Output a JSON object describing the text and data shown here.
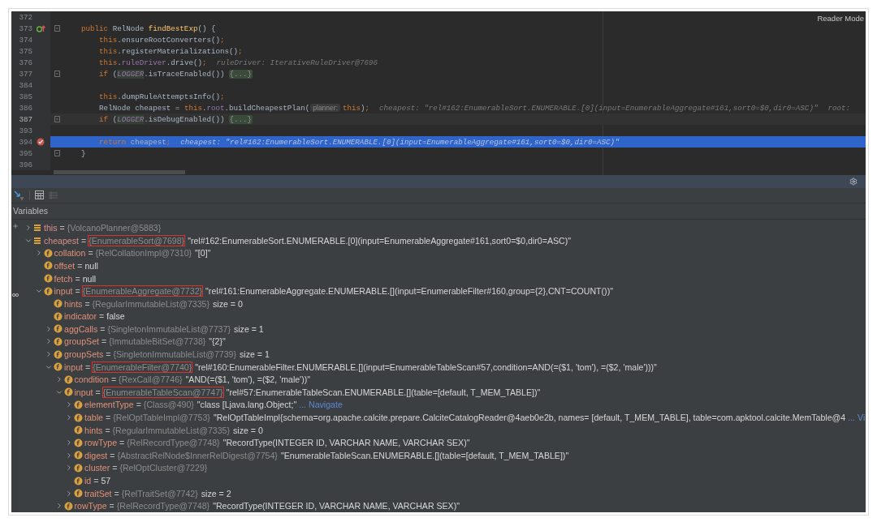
{
  "editor": {
    "reader_mode": "Reader Mode",
    "lines": [
      {
        "number": "372"
      },
      {
        "number": "373",
        "override": true,
        "fold": true,
        "parts": [
          {
            "kind": "code",
            "tokens": [
              {
                "kind": "kw",
                "t": "    public "
              },
              {
                "kind": "plain",
                "t": "RelNode "
              },
              {
                "kind": "method",
                "t": "findBestExp"
              },
              {
                "kind": "plain",
                "t": "() {"
              }
            ]
          }
        ]
      },
      {
        "number": "374",
        "parts": [
          {
            "kind": "code",
            "tokens": [
              {
                "kind": "kw",
                "t": "        this"
              },
              {
                "kind": "plain",
                "t": ".ensureRootConverters()"
              },
              {
                "kind": "kw",
                "t": ";"
              }
            ]
          }
        ]
      },
      {
        "number": "375",
        "parts": [
          {
            "kind": "code",
            "tokens": [
              {
                "kind": "kw",
                "t": "        this"
              },
              {
                "kind": "plain",
                "t": ".registerMaterializations()"
              },
              {
                "kind": "kw",
                "t": ";"
              }
            ]
          }
        ]
      },
      {
        "number": "376",
        "parts": [
          {
            "kind": "code",
            "tokens": [
              {
                "kind": "kw",
                "t": "        this"
              },
              {
                "kind": "plain",
                "t": "."
              },
              {
                "kind": "field",
                "t": "ruleDriver"
              },
              {
                "kind": "plain",
                "t": ".drive()"
              },
              {
                "kind": "kw",
                "t": ";"
              }
            ]
          },
          {
            "kind": "hint",
            "text": "ruleDriver: IterativeRuleDriver@7696"
          }
        ]
      },
      {
        "number": "377",
        "fold": true,
        "parts": [
          {
            "kind": "code",
            "tokens": [
              {
                "kind": "kw",
                "t": "        if "
              },
              {
                "kind": "plain",
                "t": "("
              },
              {
                "kind": "const",
                "t": "LOGGER"
              },
              {
                "kind": "plain",
                "t": ".isTraceEnabled())"
              }
            ]
          },
          {
            "kind": "fold",
            "text": "{...}"
          }
        ]
      },
      {
        "number": "384"
      },
      {
        "number": "385",
        "parts": [
          {
            "kind": "code",
            "tokens": [
              {
                "kind": "kw",
                "t": "        this"
              },
              {
                "kind": "plain",
                "t": ".dumpRuleAttemptsInfo()"
              },
              {
                "kind": "kw",
                "t": ";"
              }
            ]
          }
        ]
      },
      {
        "number": "386",
        "parts": [
          {
            "kind": "code",
            "tokens": [
              {
                "kind": "plain",
                "t": "        RelNode cheapest = "
              },
              {
                "kind": "kw",
                "t": "this"
              },
              {
                "kind": "plain",
                "t": "."
              },
              {
                "kind": "field",
                "t": "root"
              },
              {
                "kind": "plain",
                "t": ".buildCheapestPlan("
              }
            ]
          },
          {
            "kind": "param",
            "text": "planner:"
          },
          {
            "kind": "code",
            "tokens": [
              {
                "kind": "kw",
                "t": "this"
              },
              {
                "kind": "plain",
                "t": ")"
              },
              {
                "kind": "kw",
                "t": ";"
              }
            ]
          },
          {
            "kind": "hint",
            "text": "cheapest: \"rel#162:EnumerableSort.ENUMERABLE.[0](input=EnumerableAggregate#161,sort0=$0,dir0=ASC)\""
          },
          {
            "kind": "hint",
            "text": "root:"
          }
        ]
      },
      {
        "number": "387",
        "current": true,
        "fold": true,
        "parts": [
          {
            "kind": "code",
            "tokens": [
              {
                "kind": "kw",
                "t": "        if "
              },
              {
                "kind": "plain",
                "t": "("
              },
              {
                "kind": "const",
                "t": "LOGGER"
              },
              {
                "kind": "plain",
                "t": ".isDebugEnabled())"
              }
            ]
          },
          {
            "kind": "fold",
            "text": "{...}"
          }
        ]
      },
      {
        "number": "393"
      },
      {
        "number": "394",
        "selected": true,
        "breakpoint": true,
        "parts": [
          {
            "kind": "code",
            "tokens": [
              {
                "kind": "kw",
                "t": "        return "
              },
              {
                "kind": "plain",
                "t": "cheapest"
              },
              {
                "kind": "kw",
                "t": ";"
              }
            ]
          },
          {
            "kind": "hint",
            "text": "cheapest: \"rel#162:EnumerableSort.ENUMERABLE.[0](input=EnumerableAggregate#161,sort0=$0,dir0=ASC)\""
          }
        ]
      },
      {
        "number": "395",
        "fold": true,
        "parts": [
          {
            "kind": "code",
            "tokens": [
              {
                "kind": "plain",
                "t": "    }"
              }
            ]
          }
        ]
      },
      {
        "number": "396"
      }
    ]
  },
  "debugger": {
    "panel_title": "Variables",
    "variables": [
      {
        "kind": "local",
        "name": "this",
        "eq": "=",
        "type": "{VolcanoPlanner@5883}",
        "expanded": false
      },
      {
        "kind": "local",
        "name": "cheapest",
        "eq": "=",
        "type": "{EnumerableSort@7698}",
        "marked": true,
        "value": "\"rel#162:EnumerableSort.ENUMERABLE.[0](input=EnumerableAggregate#161,sort0=$0,dir0=ASC)\"",
        "expanded": true,
        "children": [
          {
            "kind": "field",
            "name": "collation",
            "eq": "=",
            "type": "{RelCollationImpl@7310}",
            "value": "\"[0]\"",
            "expanded": false
          },
          {
            "kind": "field",
            "name": "offset",
            "eq": "=",
            "value": "null"
          },
          {
            "kind": "field",
            "name": "fetch",
            "eq": "=",
            "value": "null"
          },
          {
            "kind": "field",
            "name": "input",
            "eq": "=",
            "type": "{EnumerableAggregate@7732}",
            "marked": true,
            "value": "\"rel#161:EnumerableAggregate.ENUMERABLE.[](input=EnumerableFilter#160,group={2},CNT=COUNT())\"",
            "expanded": true,
            "children": [
              {
                "kind": "field",
                "name": "hints",
                "eq": "=",
                "type": "{RegularImmutableList@7335}",
                "value": "size = 0"
              },
              {
                "kind": "field",
                "name": "indicator",
                "eq": "=",
                "value": "false"
              },
              {
                "kind": "field",
                "name": "aggCalls",
                "eq": "=",
                "type": "{SingletonImmutableList@7737}",
                "value": "size = 1",
                "expanded": false
              },
              {
                "kind": "field",
                "name": "groupSet",
                "eq": "=",
                "type": "{ImmutableBitSet@7738}",
                "value": "\"{2}\"",
                "expanded": false
              },
              {
                "kind": "field",
                "name": "groupSets",
                "eq": "=",
                "type": "{SingletonImmutableList@7739}",
                "value": "size = 1",
                "expanded": false
              },
              {
                "kind": "field",
                "name": "input",
                "eq": "=",
                "type": "{EnumerableFilter@7740}",
                "marked": true,
                "value": "\"rel#160:EnumerableFilter.ENUMERABLE.[](input=EnumerableTableScan#57,condition=AND(=($1, 'tom'), =($2, 'male')))\"",
                "expanded": true,
                "children": [
                  {
                    "kind": "field",
                    "name": "condition",
                    "eq": "=",
                    "type": "{RexCall@7746}",
                    "value": "\"AND(=($1, 'tom'), =($2, 'male'))\"",
                    "expanded": false
                  },
                  {
                    "kind": "field",
                    "name": "input",
                    "eq": "=",
                    "type": "{EnumerableTableScan@7747}",
                    "marked": true,
                    "value": "\"rel#57:EnumerableTableScan.ENUMERABLE.[](table=[default, T_MEM_TABLE])\"",
                    "expanded": true,
                    "children": [
                      {
                        "kind": "field",
                        "name": "elementType",
                        "eq": "=",
                        "type": "{Class@490}",
                        "value": "\"class [Ljava.lang.Object;\"",
                        "link": "... Navigate",
                        "expanded": false
                      },
                      {
                        "kind": "field",
                        "name": "table",
                        "eq": "=",
                        "type": "{RelOptTableImpl@7753}",
                        "value": "\"RelOptTableImpl{schema=org.apache.calcite.prepare.CalciteCatalogReader@4aeb0e2b, names= [default, T_MEM_TABLE], table=com.apktool.calcite.MemTable@4",
                        "link": "... Vi",
                        "expanded": false
                      },
                      {
                        "kind": "field",
                        "name": "hints",
                        "eq": "=",
                        "type": "{RegularImmutableList@7335}",
                        "value": "size = 0"
                      },
                      {
                        "kind": "field",
                        "name": "rowType",
                        "eq": "=",
                        "type": "{RelRecordType@7748}",
                        "value": "\"RecordType(INTEGER ID, VARCHAR NAME, VARCHAR SEX)\"",
                        "expanded": false
                      },
                      {
                        "kind": "field",
                        "name": "digest",
                        "eq": "=",
                        "type": "{AbstractRelNode$InnerRelDigest@7754}",
                        "value": "\"EnumerableTableScan.ENUMERABLE.[](table=[default, T_MEM_TABLE])\"",
                        "expanded": false
                      },
                      {
                        "kind": "field",
                        "name": "cluster",
                        "eq": "=",
                        "type": "{RelOptCluster@7229}",
                        "expanded": false
                      },
                      {
                        "kind": "field",
                        "name": "id",
                        "eq": "=",
                        "value": "57"
                      },
                      {
                        "kind": "field",
                        "name": "traitSet",
                        "eq": "=",
                        "type": "{RelTraitSet@7742}",
                        "value": "size = 2",
                        "expanded": false
                      }
                    ]
                  },
                  {
                    "kind": "field",
                    "name": "rowType",
                    "eq": "=",
                    "type": "{RelRecordType@7748}",
                    "value": "\"RecordType(INTEGER ID, VARCHAR NAME, VARCHAR SEX)\"",
                    "expanded": false
                  }
                ]
              }
            ]
          }
        ]
      }
    ]
  }
}
